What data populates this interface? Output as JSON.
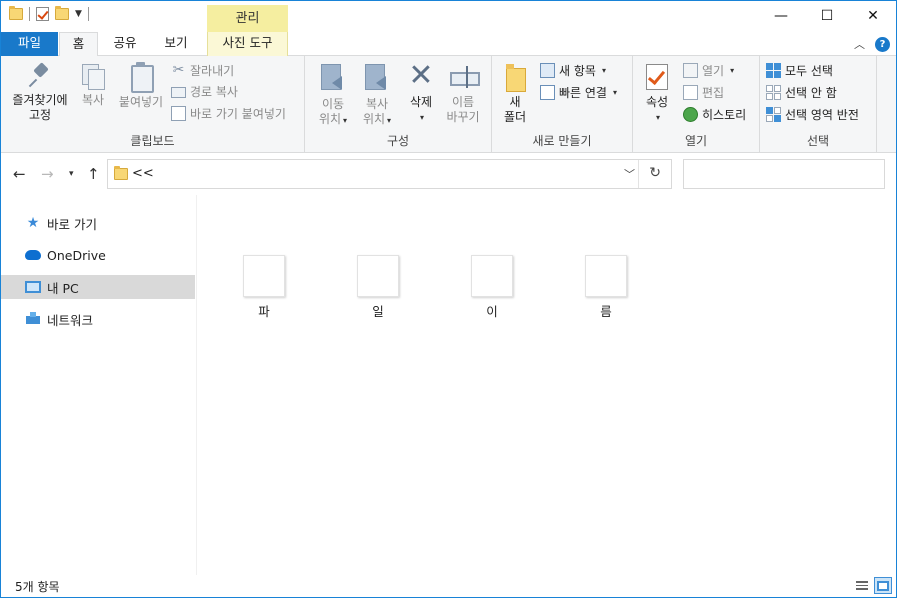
{
  "window": {
    "context_tab_header": "관리",
    "controls": {
      "minimize": "—",
      "maximize": "☐",
      "close": "✕"
    }
  },
  "tabs": {
    "file": "파일",
    "home": "홈",
    "share": "공유",
    "view": "보기",
    "context": "사진 도구"
  },
  "ribbon": {
    "clipboard": {
      "label": "클립보드",
      "pin_line1": "즐겨찾기에",
      "pin_line2": "고정",
      "copy": "복사",
      "paste": "붙여넣기",
      "cut": "잘라내기",
      "copy_path": "경로 복사",
      "paste_shortcut": "바로 가기 붙여넣기"
    },
    "organize": {
      "label": "구성",
      "move_line1": "이동",
      "move_line2": "위치",
      "copyto_line1": "복사",
      "copyto_line2": "위치",
      "delete": "삭제",
      "rename_line1": "이름",
      "rename_line2": "바꾸기"
    },
    "new": {
      "label": "새로 만들기",
      "folder_line1": "새",
      "folder_line2": "폴더",
      "new_item": "새 항목",
      "easy_access": "빠른 연결"
    },
    "open": {
      "label": "열기",
      "properties": "속성",
      "open": "열기",
      "edit": "편집",
      "history": "히스토리"
    },
    "select": {
      "label": "선택",
      "select_all": "모두 선택",
      "select_none": "선택 안 함",
      "invert": "선택 영역 반전"
    }
  },
  "address": {
    "crumb": "<<",
    "search_placeholder": ""
  },
  "navpane": {
    "items": [
      {
        "label": "바로 가기",
        "icon": "star-icon"
      },
      {
        "label": "OneDrive",
        "icon": "cloud-icon"
      },
      {
        "label": "내 PC",
        "icon": "computer-icon",
        "selected": true
      },
      {
        "label": "네트워크",
        "icon": "network-icon"
      }
    ]
  },
  "files": [
    "파",
    "일",
    "이",
    "름"
  ],
  "status": {
    "count": "5개 항목"
  }
}
